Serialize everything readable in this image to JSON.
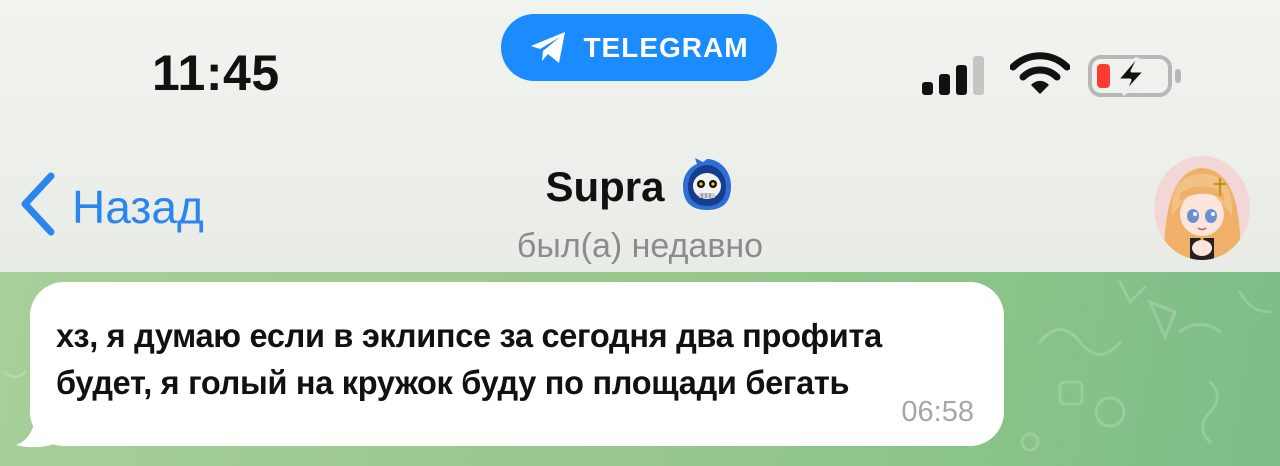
{
  "status_bar": {
    "time": "11:45",
    "pill_label": "TELEGRAM",
    "icons": [
      "telegram-icon",
      "cellular-signal-icon",
      "wifi-icon",
      "battery-charging-icon"
    ],
    "battery_level": 0.15
  },
  "header": {
    "back_label": "Назад",
    "title": "Supra",
    "title_badge_icon": "hooded-skull-emoji-icon",
    "subtitle": "был(а) недавно",
    "avatar": "anime-girl-avatar"
  },
  "message": {
    "text": "хз, я думаю если в эклипсе за сегодня два профита будет, я голый на кружок буду по площади бегать",
    "time": "06:58"
  },
  "colors": {
    "accent": "#2a86ef",
    "telegram_pill": "#1a8cff",
    "chat_background": "#9cc88f",
    "bubble": "#ffffff",
    "battery_low": "#ff3b30"
  }
}
